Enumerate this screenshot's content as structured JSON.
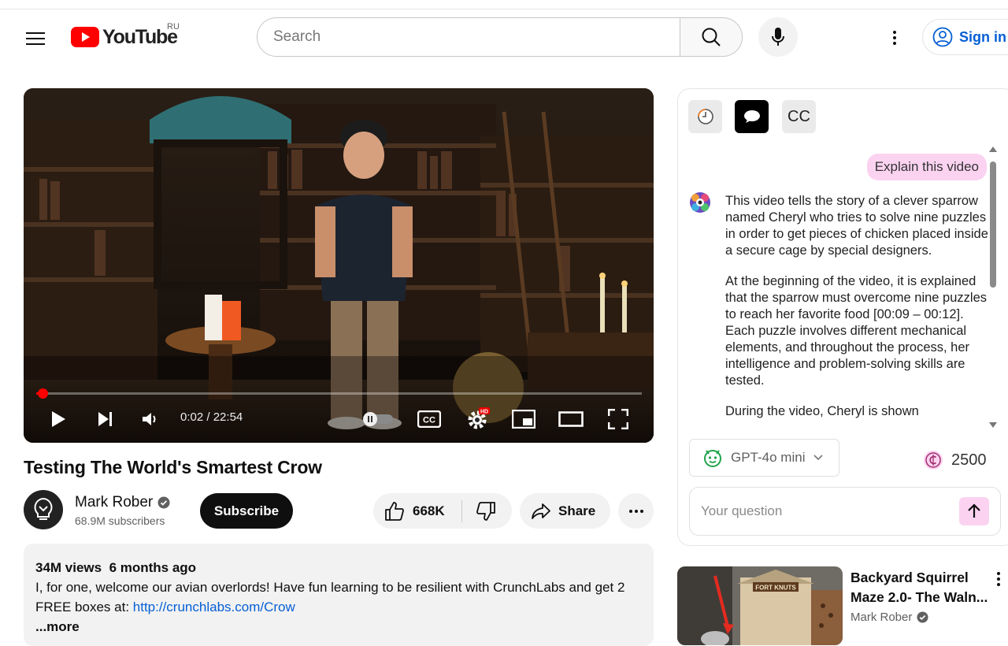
{
  "header": {
    "logo_text": "YouTube",
    "region": "RU",
    "search_placeholder": "Search",
    "signin_label": "Sign in"
  },
  "player": {
    "time_current": "0:02",
    "time_separator": "/",
    "time_total": "22:54",
    "progress_fraction": 0.0015,
    "settings_badge": "HD",
    "cc_label": "CC"
  },
  "video": {
    "title": "Testing The World's Smartest Crow",
    "channel": "Mark Rober",
    "subscribers": "68.9M subscribers",
    "subscribe_label": "Subscribe",
    "likes": "668K",
    "share_label": "Share"
  },
  "description": {
    "views": "34M views",
    "age": "6 months ago",
    "text": "I, for one, welcome our avian overlords! Have fun learning to be resilient with CrunchLabs and get 2 FREE boxes at: ",
    "link": "http://crunchlabs.com/Crow",
    "more_label": "...more"
  },
  "assistant": {
    "tab_cc_label": "CC",
    "user_message": "Explain this video",
    "response_paragraphs": [
      "This video tells the story of a clever sparrow named Cheryl who tries to solve nine puzzles in order to get pieces of chicken placed inside a secure cage by special designers.",
      "At the beginning of the video, it is explained that the sparrow must overcome nine puzzles to reach her favorite food [00:09 – 00:12]. Each puzzle involves different mechanical elements, and throughout the process, her intelligence and problem-solving skills are tested.",
      "During the video, Cheryl is shown"
    ],
    "model_name": "GPT-4o mini",
    "credits": "2500",
    "question_placeholder": "Your question"
  },
  "recommendation": {
    "title_line1": "Backyard Squirrel",
    "title_line2": "Maze 2.0- The Waln...",
    "channel": "Mark Rober",
    "thumb_sign": "FORT KNUTS"
  },
  "colors": {
    "youtube_red": "#ff0000",
    "link_blue": "#065fd4",
    "assistant_pink": "#fbd3f1",
    "model_green": "#1fa34a"
  }
}
